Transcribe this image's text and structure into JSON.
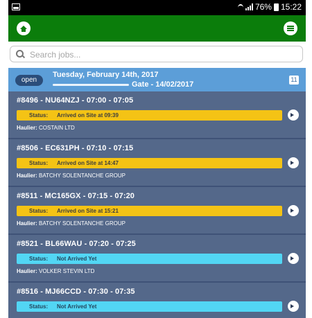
{
  "status_bar": {
    "icons": "wifi-signal-battery",
    "battery": "76%",
    "time": "15:22"
  },
  "search": {
    "placeholder": "Search jobs..."
  },
  "date_header": {
    "badge": "open",
    "date": "Tuesday, February 14th, 2017",
    "gate": "Gate - 14/02/2017",
    "count": "11"
  },
  "jobs": [
    {
      "title": "#8496 - NU64NZJ - 07:00 - 07:05",
      "status_label": "Status:",
      "status": "Arrived on Site at 09:39",
      "haulier_label": "Haulier:",
      "haulier": "COSTAIN LTD"
    },
    {
      "title": "#8506 - EC631PH - 07:10 - 07:15",
      "status_label": "Status:",
      "status": "Arrived on Site at 14:47",
      "haulier_label": "Haulier:",
      "haulier": "BATCHY SOLENTANCHE GROUP"
    },
    {
      "title": "#8511 - MC165GX - 07:15 - 07:20",
      "status_label": "Status:",
      "status": "Arrived on Site at 15:21",
      "haulier_label": "Haulier:",
      "haulier": "BATCHY SOLENTANCHE GROUP"
    },
    {
      "title": "#8521 - BL66WAU - 07:20 - 07:25",
      "status_label": "Status:",
      "status": "Not Arrived Yet",
      "haulier_label": "Haulier:",
      "haulier": "VOLKER STEVIN LTD"
    },
    {
      "title": "#8516 - MJ66CCD - 07:30 - 07:35",
      "status_label": "Status:",
      "status": "Not Arrived Yet",
      "haulier_label": "",
      "haulier": ""
    }
  ],
  "colors": {
    "appbar": "#0b7d0b",
    "date_header": "#5c9ed8",
    "list_bg": "#54688a",
    "status_arrived": "#f4c315",
    "status_not_arrived": "#52d6f4"
  }
}
